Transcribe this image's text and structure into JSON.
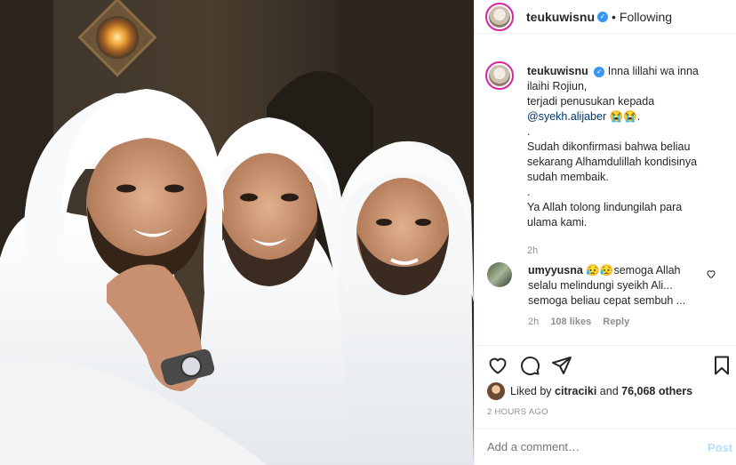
{
  "header": {
    "username": "teukuwisnu",
    "separator": "•",
    "following_label": "Following"
  },
  "caption": {
    "username": "teukuwisnu",
    "line1": "Inna lillahi wa inna ilaihi Rojiun,",
    "line2": "terjadi penusukan kepada",
    "mention": "@syekh.alijaber",
    "emoji": "😭😭.",
    "dot1": ".",
    "line3": "Sudah dikonfirmasi bahwa beliau sekarang Alhamdulillah kondisinya sudah membaik.",
    "dot2": ".",
    "line4": "Ya Allah tolong lindungilah para ulama kami.",
    "time": "2h"
  },
  "reply": {
    "username": "umyyusna",
    "text": "😥😥semoga Allah selalu melindungi syeikh Ali... semoga beliau cepat sembuh ...",
    "time": "2h",
    "likes": "108 likes",
    "reply_label": "Reply"
  },
  "likes": {
    "prefix": "Liked by",
    "user": "citraciki",
    "middle": "and",
    "count": "76,068 others"
  },
  "timestamp": "2 HOURS AGO",
  "comment_box": {
    "placeholder": "Add a comment…",
    "post_label": "Post"
  },
  "colors": {
    "link": "#00376b",
    "secondary": "#8e8e8e",
    "verified": "#3897f0",
    "post_disabled": "#b2dffc"
  },
  "icons": {
    "like": "heart-outline-icon",
    "comment": "speech-bubble-icon",
    "share": "paper-plane-icon",
    "save": "bookmark-icon"
  }
}
